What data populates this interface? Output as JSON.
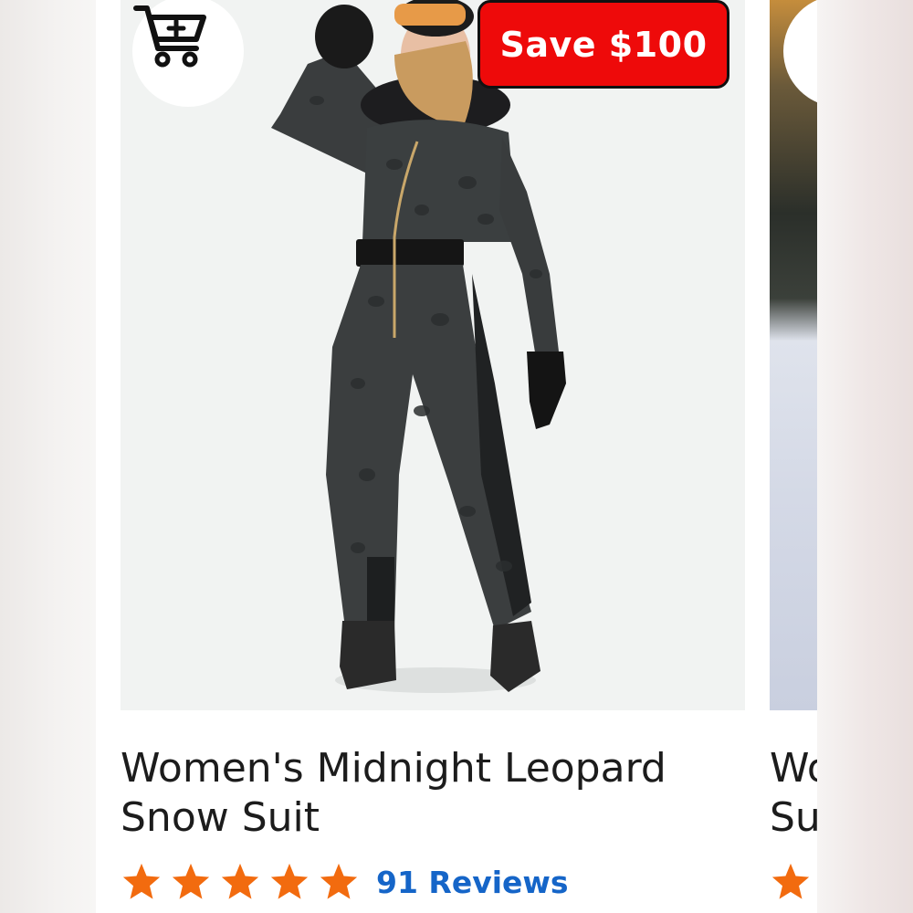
{
  "product": {
    "title": "Women's Midnight Leopard Snow Suit",
    "badge": "Save $100",
    "rating": 5,
    "max_rating": 5,
    "reviews_label": "91 Reviews"
  },
  "next_product": {
    "title_visible": "Wo\nSu"
  },
  "icons": {
    "cart": "cart-plus-icon",
    "star": "star-icon"
  },
  "colors": {
    "badge_bg": "#ee0a0a",
    "star": "#f26b0f",
    "reviews_link": "#1565c8",
    "title_text": "#1c1c1c"
  }
}
